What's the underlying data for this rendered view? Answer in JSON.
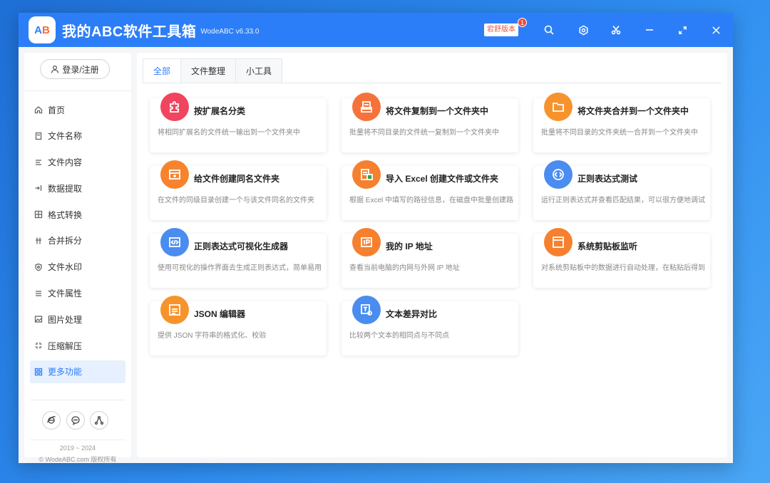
{
  "app": {
    "logo_text_a": "A",
    "logo_text_b": "B",
    "title": "我的ABC软件工具箱",
    "version": "WodeABC v6.33.0",
    "upgrade_label": "宕舒版本",
    "badge_count": "1"
  },
  "sidebar": {
    "login_label": "登录/注册",
    "items": [
      {
        "label": "首页",
        "icon": "home-icon"
      },
      {
        "label": "文件名称",
        "icon": "file-name-icon"
      },
      {
        "label": "文件内容",
        "icon": "file-content-icon"
      },
      {
        "label": "数据提取",
        "icon": "data-extract-icon"
      },
      {
        "label": "格式转换",
        "icon": "format-convert-icon"
      },
      {
        "label": "合并拆分",
        "icon": "merge-split-icon"
      },
      {
        "label": "文件水印",
        "icon": "watermark-icon"
      },
      {
        "label": "文件属性",
        "icon": "file-attr-icon"
      },
      {
        "label": "图片处理",
        "icon": "image-icon"
      },
      {
        "label": "压缩解压",
        "icon": "compress-icon"
      },
      {
        "label": "更多功能",
        "icon": "more-icon"
      }
    ],
    "active_index": 10,
    "copyright_years": "2019 ~ 2024",
    "copyright_owner": "© WodeABC.com 版权所有"
  },
  "tabs": [
    {
      "label": "全部"
    },
    {
      "label": "文件整理"
    },
    {
      "label": "小工具"
    }
  ],
  "cards": [
    {
      "title": "按扩展名分类",
      "desc": "将相同扩展名的文件统一输出到一个文件夹中",
      "color": "#f0445f",
      "icon": "puzzle-icon"
    },
    {
      "title": "将文件复制到一个文件夹中",
      "desc": "批量将不同目录的文件统一复制到一个文件夹中",
      "color": "#f5733a",
      "icon": "copy-file-icon"
    },
    {
      "title": "将文件夹合并到一个文件夹中",
      "desc": "批量将不同目录的文件夹统一合并到一个文件夹中",
      "color": "#f7932c",
      "icon": "folder-icon"
    },
    {
      "title": "给文件创建同名文件夹",
      "desc": "在文件的同级目录创建一个与该文件同名的文件夹",
      "color": "#f7842d",
      "icon": "create-folder-icon"
    },
    {
      "title": "导入 Excel 创建文件或文件夹",
      "desc": "根据 Excel 中填写的路径信息，在磁盘中批量创建路径",
      "color": "#f6802e",
      "icon": "excel-icon"
    },
    {
      "title": "正则表达式测试",
      "desc": "运行正则表达式并查看匹配结果，可以很方便地调试",
      "color": "#4a8cf0",
      "icon": "regex-test-icon"
    },
    {
      "title": "正则表达式可视化生成器",
      "desc": "使用可视化的操作界面去生成正则表达式，简单易用",
      "color": "#4a8cf0",
      "icon": "code-icon"
    },
    {
      "title": "我的 IP 地址",
      "desc": "查看当前电脑的内网与外网 IP 地址",
      "color": "#f6802e",
      "icon": "ip-icon"
    },
    {
      "title": "系统剪贴板监听",
      "desc": "对系统剪贴板中的数据进行自动处理，在粘贴后得到结果",
      "color": "#f6802e",
      "icon": "clipboard-icon"
    },
    {
      "title": "JSON 编辑器",
      "desc": "提供 JSON 字符串的格式化、校验",
      "color": "#f7932c",
      "icon": "json-icon"
    },
    {
      "title": "文本差异对比",
      "desc": "比较两个文本的相同点与不同点",
      "color": "#4a8cf0",
      "icon": "text-diff-icon"
    }
  ]
}
